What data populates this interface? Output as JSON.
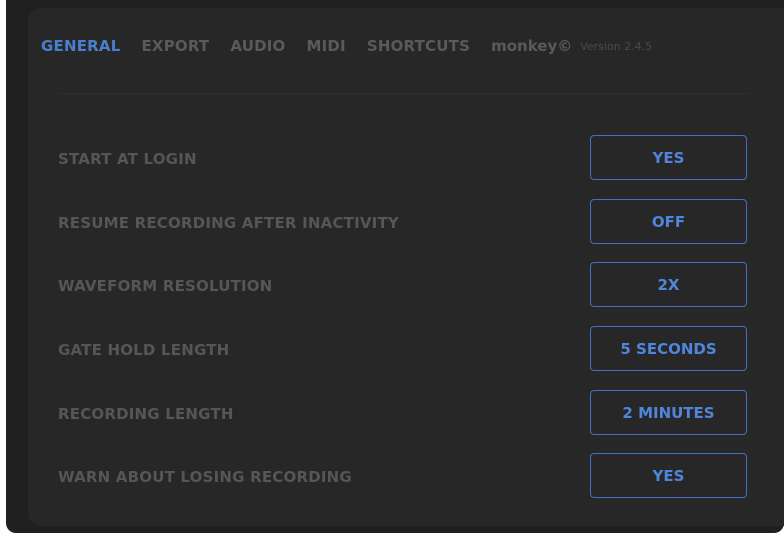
{
  "tabs": [
    {
      "label": "GENERAL",
      "active": true
    },
    {
      "label": "EXPORT",
      "active": false
    },
    {
      "label": "AUDIO",
      "active": false
    },
    {
      "label": "MIDI",
      "active": false
    },
    {
      "label": "SHORTCUTS",
      "active": false
    }
  ],
  "brand": "monkey©",
  "version": "Version 2.4.5",
  "settings": [
    {
      "label": "START AT LOGIN",
      "value": "YES"
    },
    {
      "label": "RESUME RECORDING AFTER INACTIVITY",
      "value": "OFF"
    },
    {
      "label": "WAVEFORM RESOLUTION",
      "value": "2X"
    },
    {
      "label": "GATE HOLD LENGTH",
      "value": "5 SECONDS"
    },
    {
      "label": "RECORDING LENGTH",
      "value": "2 MINUTES"
    },
    {
      "label": "WARN ABOUT LOSING RECORDING",
      "value": "YES"
    }
  ],
  "colors": {
    "accent": "#4a7fd0",
    "background": "#202020",
    "panel": "#272727",
    "muted_text": "#565656"
  }
}
